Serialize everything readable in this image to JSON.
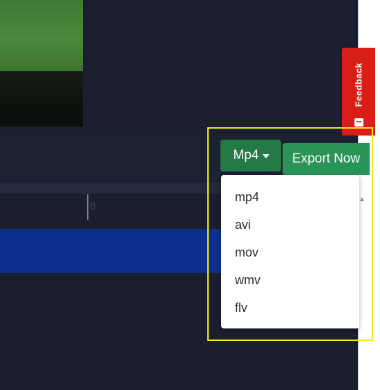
{
  "feedback": {
    "label": "Feedback"
  },
  "export": {
    "format_selected": "Mp4",
    "export_label": "Export Now",
    "format_options": [
      "mp4",
      "avi",
      "mov",
      "wmv",
      "flv"
    ]
  },
  "timeline": {
    "time_marker": "8"
  },
  "colors": {
    "background": "#1b1f30",
    "accent_green": "#237a44",
    "export_green": "#2a9456",
    "feedback_red": "#d91e18",
    "clip_blue": "#0c2e8c",
    "highlight_yellow": "#f2ea1b"
  }
}
